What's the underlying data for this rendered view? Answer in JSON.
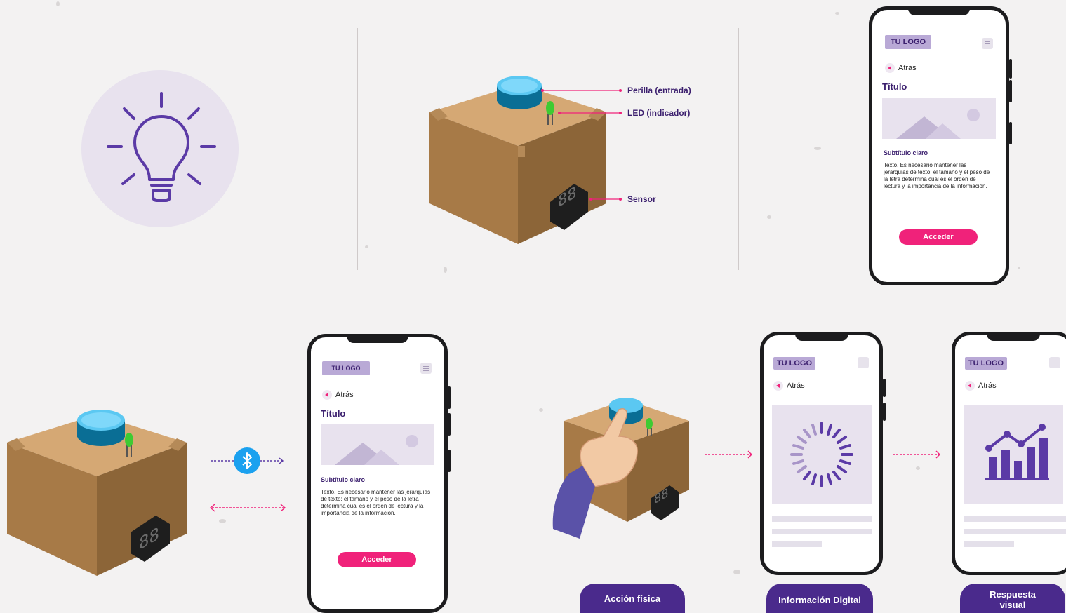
{
  "callouts": {
    "knob": "Perilla (entrada)",
    "led": "LED (indicador)",
    "sensor": "Sensor"
  },
  "phone_screen": {
    "logo": "TU LOGO",
    "back": "Atrás",
    "title": "Título",
    "subtitle": "Subtítulo claro",
    "body": "Texto. Es necesario mantener las jerarquías de texto; el tamaño y el peso de la letra determina cual es el orden de lectura y la importancia de la información.",
    "button": "Acceder"
  },
  "display_digits": "88",
  "steps": [
    {
      "label": "Acción física"
    },
    {
      "label": "Información Digital"
    },
    {
      "label": "Respuesta visual"
    }
  ],
  "colors": {
    "accent": "#f0227a",
    "purple_dark": "#3b1f6e",
    "pill": "#4a2a8c",
    "logo_bg": "#b9a9d6",
    "lavender": "#e8e2ee",
    "bluetooth": "#1ba1ef",
    "box": "#c89c67",
    "knob": "#5bc8f2"
  },
  "icons": [
    "lightbulb-icon",
    "bluetooth-icon",
    "loading-spinner-icon",
    "bar-chart-icon",
    "hand-icon"
  ]
}
